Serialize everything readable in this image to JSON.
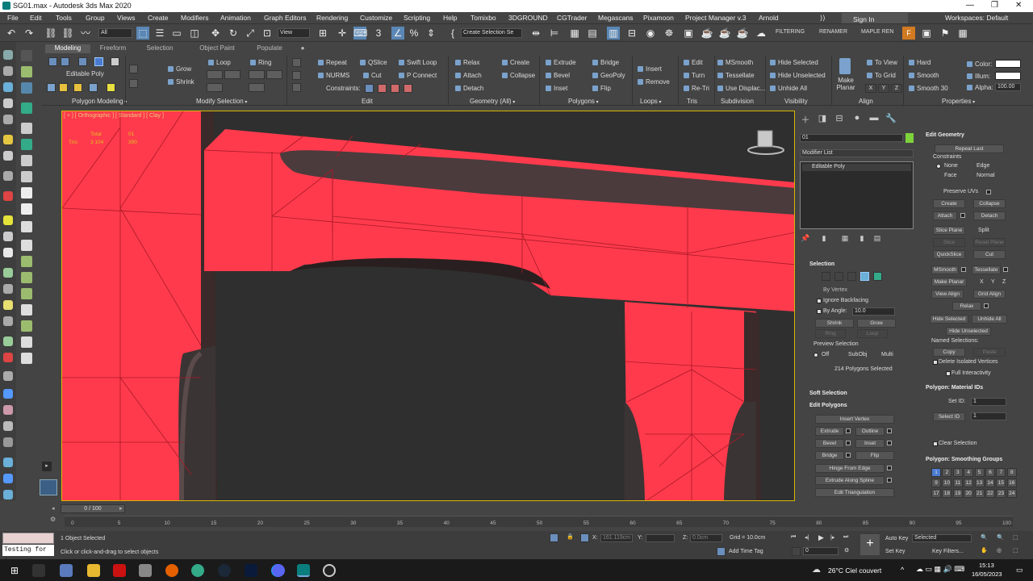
{
  "titlebar": {
    "title": "SG01.max - Autodesk 3ds Max 2020"
  },
  "menu": [
    "File",
    "Edit",
    "Tools",
    "Group",
    "Views",
    "Create",
    "Modifiers",
    "Animation",
    "Graph Editors",
    "Rendering",
    "Customize",
    "Scripting",
    "Help",
    "Tomixbo",
    "3DGROUND",
    "CGTrader",
    "Megascans",
    "Pixamoon",
    "Project Manager v.3",
    "Arnold"
  ],
  "account": {
    "sign_in": "Sign In",
    "workspaces": "Workspaces: Default"
  },
  "toolbar": {
    "filter": "All",
    "view": "View",
    "selection_set": "Create Selection Se",
    "filtering": "FILTERING",
    "renamer": "RENAMER",
    "maple_ren": "MAPLE REN",
    "icons_pct": "%"
  },
  "ribbon": {
    "tabs": [
      "Modeling",
      "Freeform",
      "Selection",
      "Object Paint",
      "Populate"
    ],
    "editable_poly": "Editable Poly",
    "groups": [
      "Polygon Modeling",
      "Modify Selection",
      "Edit",
      "Geometry (All)",
      "Polygons",
      "Loops",
      "Tris",
      "Subdivision",
      "Visibility",
      "Align",
      "Properties"
    ],
    "modify_selection": {
      "grow": "Grow",
      "shrink": "Shrink",
      "loop": "Loop",
      "ring": "Ring"
    },
    "edit": {
      "repeat": "Repeat",
      "nurms": "NURMS",
      "constraints": "Constraints:",
      "qslice": "QSlice",
      "cut": "Cut",
      "swift_loop": "Swift Loop",
      "p_connect": "P Connect"
    },
    "geometry": {
      "relax": "Relax",
      "attach": "Attach",
      "detach": "Detach",
      "create": "Create",
      "collapse": "Collapse"
    },
    "polygons": {
      "extrude": "Extrude",
      "bevel": "Bevel",
      "inset": "Inset",
      "bridge": "Bridge",
      "geopoly": "GeoPoly",
      "flip": "Flip"
    },
    "loops": {
      "insert": "Insert",
      "remove": "Remove"
    },
    "tris": {
      "edit": "Edit",
      "turn": "Turn",
      "retri": "Re-Tri"
    },
    "subdivision": {
      "msmooth": "MSmooth",
      "tessellate": "Tessellate",
      "use_displac": "Use Displac..."
    },
    "visibility": {
      "hide_selected": "Hide Selected",
      "hide_unselected": "Hide Unselected",
      "unhide_all": "Unhide All"
    },
    "align": {
      "make_planar": "Make Planar",
      "to_view": "To View",
      "to_grid": "To Grid",
      "x": "X",
      "y": "Y",
      "z": "Z"
    },
    "smoothing": {
      "hard": "Hard",
      "smooth": "Smooth",
      "smooth30": "Smooth 30"
    },
    "properties": {
      "color": "Color:",
      "illum": "Illum:",
      "alpha": "Alpha:",
      "alpha_val": "100.00"
    }
  },
  "viewport": {
    "label": "[ + ] [ Orthographic ] [ Standard ] [ Clay ]",
    "stats": {
      "total": "Total",
      "obj": "01",
      "tris_label": "Tris:",
      "tris_total": "3 104",
      "tris_obj": "390"
    },
    "mesh_color": "#ff3a4c"
  },
  "command_panel": {
    "object_name": "01",
    "modifier_list": "Modifier List",
    "stack_item": "Editable Poly",
    "selection": {
      "title": "Selection",
      "by_vertex": "By Vertex",
      "ignore_backfacing": "Ignore Backfacing",
      "by_angle": "By Angle:",
      "angle_val": "10.0",
      "shrink": "Shrink",
      "grow": "Grow",
      "ring": "Ring",
      "loop": "Loop",
      "preview": "Preview Selection",
      "off": "Off",
      "subobj": "SubObj",
      "multi": "Multi",
      "selected_count": "214 Polygons Selected"
    },
    "soft_selection": "Soft Selection",
    "edit_polygons": {
      "title": "Edit Polygons",
      "insert_vertex": "Insert Vertex",
      "extrude": "Extrude",
      "outline": "Outline",
      "bevel": "Bevel",
      "inset": "Inset",
      "bridge": "Bridge",
      "flip": "Flip",
      "hinge": "Hinge From Edge",
      "extrude_spline": "Extrude Along Spline",
      "edit_tri": "Edit Triangulation"
    },
    "edit_geometry": {
      "title": "Edit Geometry",
      "repeat_last": "Repeat Last",
      "constraints": "Constraints",
      "none": "None",
      "edge": "Edge",
      "face": "Face",
      "normal": "Normal",
      "preserve_uvs": "Preserve UVs",
      "create": "Create",
      "collapse": "Collapse",
      "attach": "Attach",
      "detach": "Detach",
      "slice_plane": "Slice Plane",
      "split": "Split",
      "slice": "Slice",
      "reset_plane": "Reset Plane",
      "quickslice": "QuickSlice",
      "cut": "Cut",
      "msmooth": "MSmooth",
      "tessellate": "Tessellate",
      "make_planar": "Make Planar",
      "x": "X",
      "y": "Y",
      "z": "Z",
      "view_align": "View Align",
      "grid_align": "Grid Align",
      "relax": "Relax",
      "hide_selected": "Hide Selected",
      "unhide_all": "Unhide All",
      "hide_unselected": "Hide Unselected",
      "named_selections": "Named Selections:",
      "copy": "Copy",
      "paste": "Paste",
      "delete_isolated": "Delete Isolated Vertices",
      "full_interactivity": "Full Interactivity"
    },
    "material_ids": {
      "title": "Polygon: Material IDs",
      "set_id": "Set ID:",
      "set_val": "1",
      "select_id": "Select ID",
      "select_val": "1",
      "clear_selection": "Clear Selection"
    },
    "smoothing_groups": {
      "title": "Polygon: Smoothing Groups",
      "numbers": [
        "1",
        "2",
        "3",
        "4",
        "5",
        "6",
        "7",
        "8",
        "9",
        "10",
        "11",
        "12",
        "13",
        "14",
        "15",
        "16",
        "17",
        "18",
        "19",
        "20",
        "21",
        "22",
        "23",
        "24"
      ]
    }
  },
  "timeline": {
    "frame": "0 / 100",
    "ticks": [
      "0",
      "5",
      "10",
      "15",
      "20",
      "25",
      "30",
      "35",
      "40",
      "45",
      "50",
      "55",
      "60",
      "65",
      "70",
      "75",
      "80",
      "85",
      "90",
      "95",
      "100"
    ]
  },
  "status": {
    "script": "Testing for :",
    "objects_selected": "1 Object Selected",
    "hint": "Click or click-and-drag to select objects",
    "x_label": "X:",
    "x_val": "161.119cm",
    "y_label": "Y:",
    "z_label": "Z:",
    "z_val": "0.0cm",
    "grid": "Grid = 10.0cm",
    "add_time_tag": "Add Time Tag",
    "auto_key": "Auto Key",
    "selected": "Selected",
    "set_key": "Set Key",
    "key_filters": "Key Filters...",
    "frame_val": "0"
  },
  "taskbar": {
    "weather": "26°C  Ciel couvert",
    "time": "15:13",
    "date": "16/05/2023"
  }
}
